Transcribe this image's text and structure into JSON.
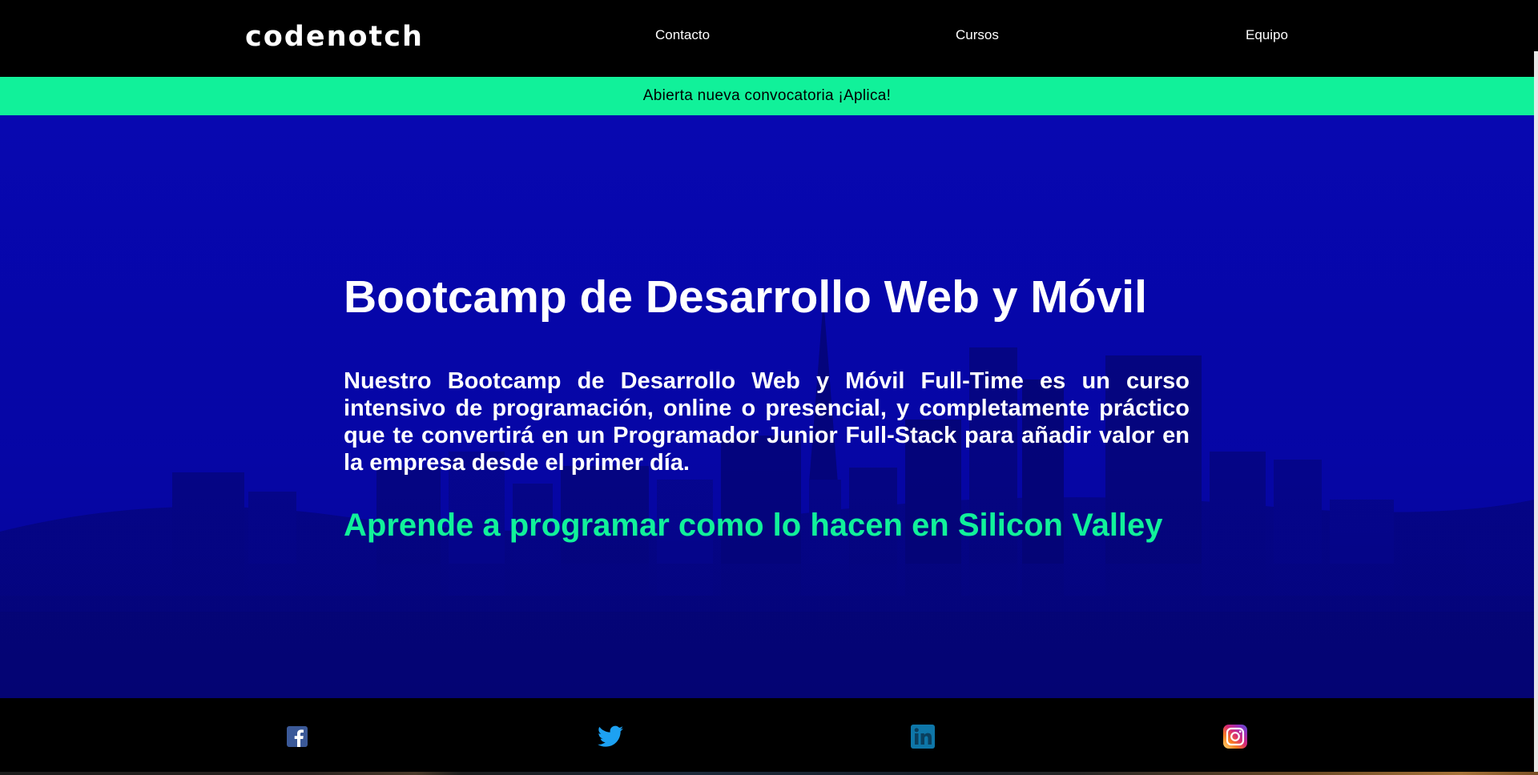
{
  "header": {
    "logo_text": "codenotch",
    "nav": {
      "contacto": "Contacto",
      "cursos": "Cursos",
      "equipo": "Equipo"
    }
  },
  "banner": {
    "text": "Abierta nueva convocatoria ¡Aplica!"
  },
  "hero": {
    "title": "Bootcamp de Desarrollo Web y Móvil",
    "description": "Nuestro Bootcamp de Desarrollo Web y Móvil Full-Time es un curso intensivo de programación, online o presencial, y completamente práctico que te convertirá en un Programador Junior Full-Stack para añadir valor en la empresa desde el primer día.",
    "tagline": "Aprende a programar como lo hacen en Silicon Valley"
  },
  "footer": {
    "social": [
      {
        "icon": "facebook-icon"
      },
      {
        "icon": "twitter-icon"
      },
      {
        "icon": "linkedin-icon"
      },
      {
        "icon": "instagram-icon"
      }
    ]
  },
  "colors": {
    "accent": "#11f19a",
    "hero_blue": "#0707c0",
    "background": "#000000",
    "text": "#ffffff"
  }
}
